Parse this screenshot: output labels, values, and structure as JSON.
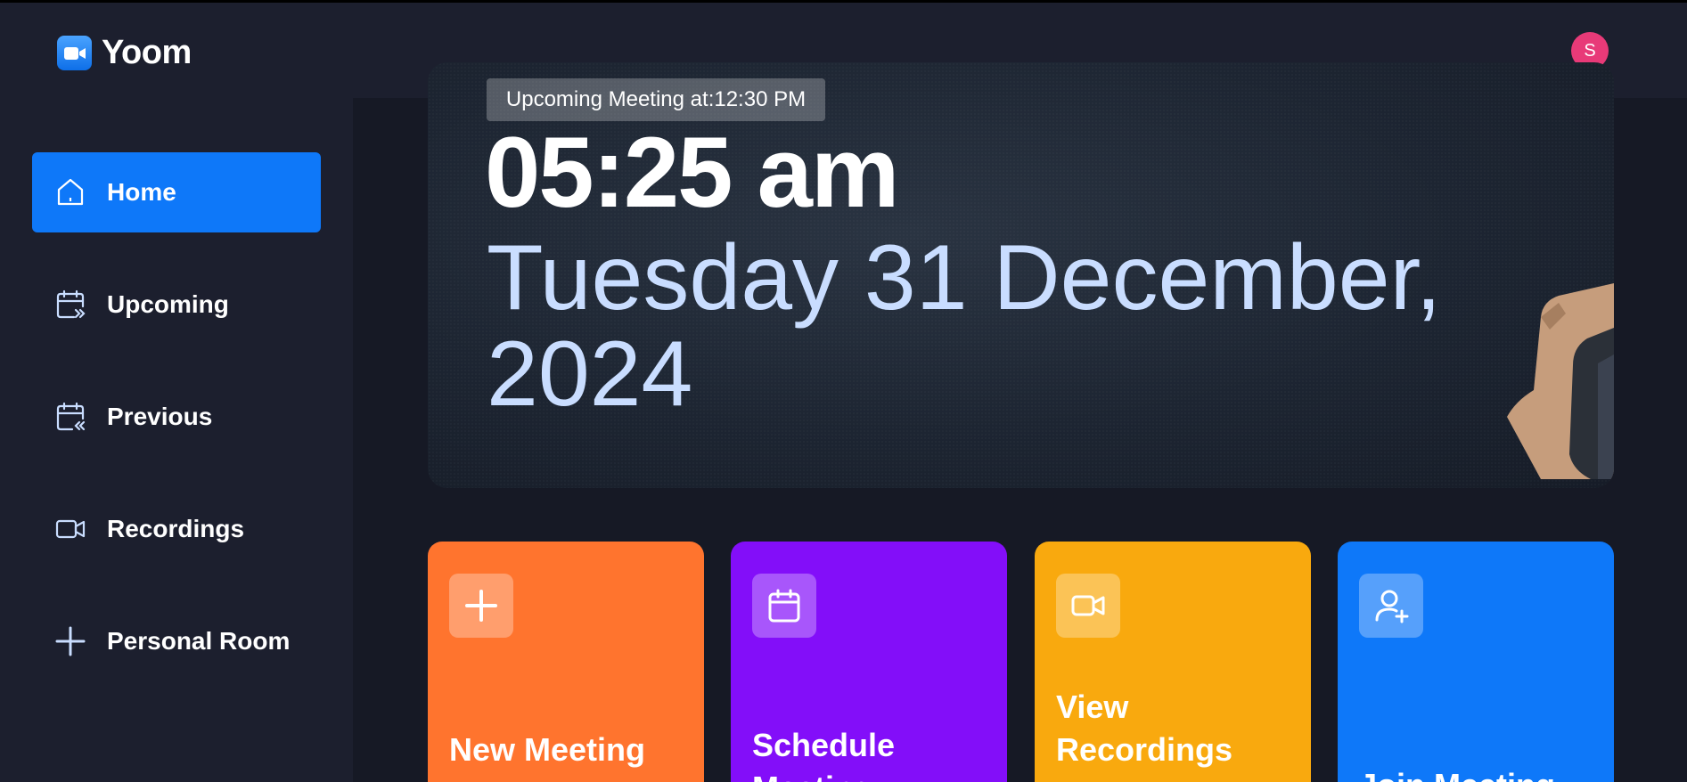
{
  "app": {
    "name": "Yoom",
    "user_initial": "S"
  },
  "sidebar": {
    "items": [
      {
        "label": "Home",
        "icon": "home-icon",
        "active": true
      },
      {
        "label": "Upcoming",
        "icon": "calendar-forward-icon",
        "active": false
      },
      {
        "label": "Previous",
        "icon": "calendar-back-icon",
        "active": false
      },
      {
        "label": "Recordings",
        "icon": "video-icon",
        "active": false
      },
      {
        "label": "Personal Room",
        "icon": "plus-icon",
        "active": false
      }
    ]
  },
  "hero": {
    "badge": "Upcoming Meeting at:12:30 PM",
    "time": "05:25 am",
    "date": "Tuesday 31 December, 2024"
  },
  "cards": [
    {
      "title": "New Meeting",
      "icon": "plus-icon",
      "color": "#ff742e"
    },
    {
      "title": "Schedule Meeting",
      "icon": "calendar-icon",
      "color": "#830ef9"
    },
    {
      "title": "View Recordings",
      "icon": "video-icon",
      "color": "#f9a90e"
    },
    {
      "title": "Join Meeting",
      "icon": "user-plus-icon",
      "color": "#0e78f9"
    }
  ],
  "colors": {
    "background": "#1c1f2e",
    "main_background": "#161925",
    "accent": "#0e78f9",
    "avatar": "#e83a78"
  }
}
